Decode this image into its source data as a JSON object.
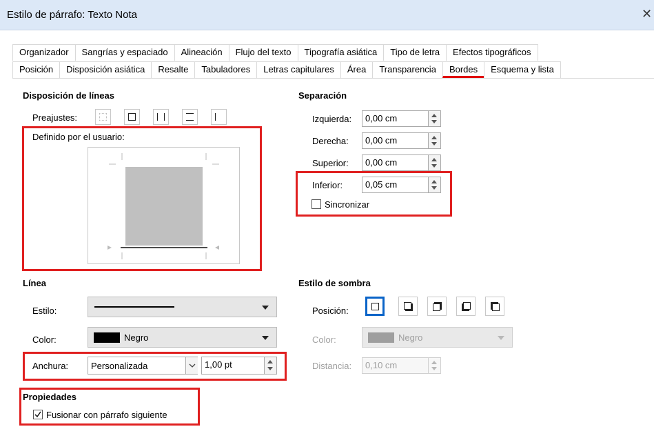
{
  "window": {
    "title": "Estilo de párrafo: Texto  Nota",
    "close_glyph": "✕"
  },
  "tabs_row1": [
    "Organizador",
    "Sangrías y espaciado",
    "Alineación",
    "Flujo del texto",
    "Tipografía asiática",
    "Tipo de letra",
    "Efectos tipográficos"
  ],
  "tabs_row2": [
    "Posición",
    "Disposición asiática",
    "Resalte",
    "Tabuladores",
    "Letras capitulares",
    "Área",
    "Transparencia",
    "Bordes",
    "Esquema y lista"
  ],
  "active_tab": "Bordes",
  "line_arrangement": {
    "heading": "Disposición de líneas",
    "presets_label": "Preajustes:",
    "user_defined_label": "Definido por el usuario:"
  },
  "padding": {
    "heading": "Separación",
    "left": {
      "label": "Izquierda:",
      "value": "0,00 cm"
    },
    "right": {
      "label": "Derecha:",
      "value": "0,00 cm"
    },
    "top": {
      "label": "Superior:",
      "value": "0,00 cm"
    },
    "bottom": {
      "label": "Inferior:",
      "value": "0,05 cm"
    },
    "sync": {
      "label": "Sincronizar",
      "checked": false
    }
  },
  "line": {
    "heading": "Línea",
    "style_label": "Estilo:",
    "color_label": "Color:",
    "color_value": "Negro",
    "color_hex": "#000000",
    "width_label": "Anchura:",
    "width_preset": "Personalizada",
    "width_value": "1,00 pt"
  },
  "shadow": {
    "heading": "Estilo de sombra",
    "position_label": "Posición:",
    "color_label": "Color:",
    "color_value": "Negro",
    "color_hex": "#9e9e9e",
    "distance_label": "Distancia:",
    "distance_value": "0,10 cm"
  },
  "properties": {
    "heading": "Propiedades",
    "merge": {
      "label": "Fusionar con párrafo siguiente",
      "checked": true
    }
  },
  "colors": {
    "highlight": "#e02020",
    "selected": "#0a64c8",
    "titlebar": "#dce8f7"
  }
}
